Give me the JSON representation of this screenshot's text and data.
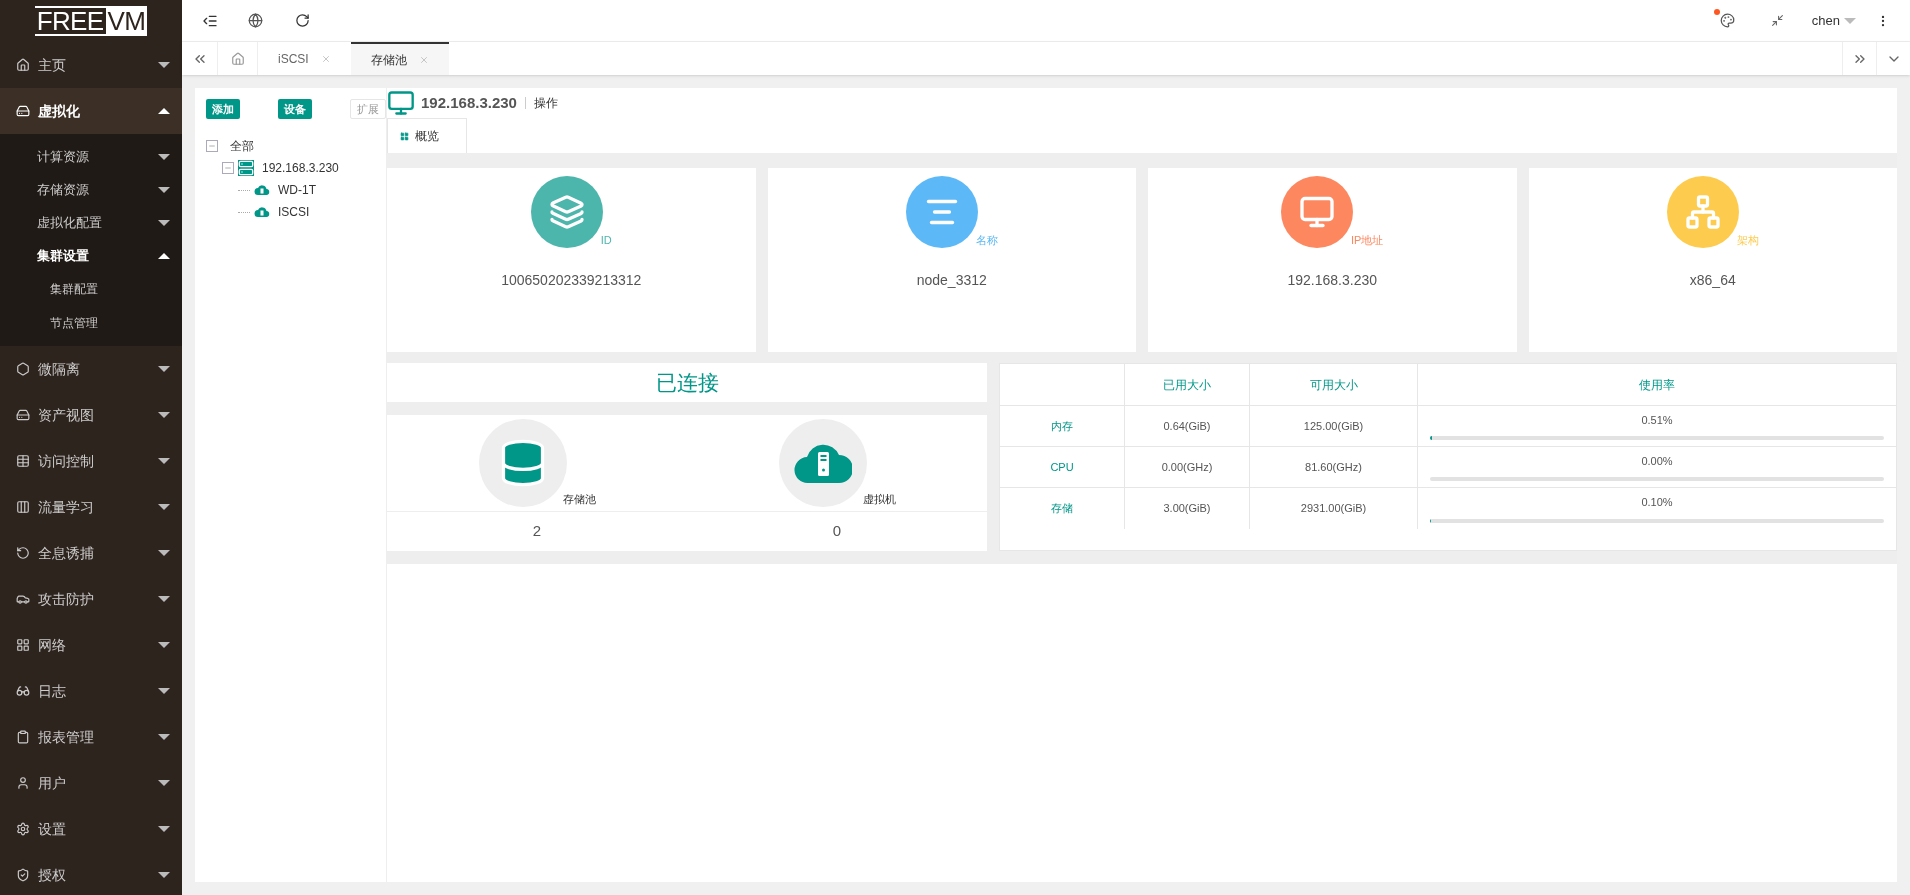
{
  "logo": {
    "part_1": "FREE",
    "part_2": "VM"
  },
  "top_bar": {
    "user": "chen",
    "notification": true
  },
  "tabs": [
    {
      "label": "iSCSI",
      "selected": false
    },
    {
      "label": "存储池",
      "selected": true
    }
  ],
  "sidebar": {
    "items": [
      {
        "label": "主页",
        "expanded": false,
        "selected": false
      },
      {
        "label": "虚拟化",
        "expanded": true,
        "selected": true,
        "children": [
          {
            "label": "计算资源",
            "expanded": false,
            "selected": false
          },
          {
            "label": "存储资源",
            "expanded": false,
            "selected": false
          },
          {
            "label": "虚拟化配置",
            "expanded": false,
            "selected": false
          },
          {
            "label": "集群设置",
            "expanded": true,
            "selected": true,
            "children": [
              {
                "label": "集群配置",
                "selected": false
              },
              {
                "label": "节点管理",
                "selected": false
              }
            ]
          }
        ]
      },
      {
        "label": "微隔离",
        "expanded": false,
        "selected": false
      },
      {
        "label": "资产视图",
        "expanded": false,
        "selected": false
      },
      {
        "label": "访问控制",
        "expanded": false,
        "selected": false
      },
      {
        "label": "流量学习",
        "expanded": false,
        "selected": false
      },
      {
        "label": "全息诱捕",
        "expanded": false,
        "selected": false
      },
      {
        "label": "攻击防护",
        "expanded": false,
        "selected": false
      },
      {
        "label": "网络",
        "expanded": false,
        "selected": false
      },
      {
        "label": "日志",
        "expanded": false,
        "selected": false
      },
      {
        "label": "报表管理",
        "expanded": false,
        "selected": false
      },
      {
        "label": "用户",
        "expanded": false,
        "selected": false
      },
      {
        "label": "设置",
        "expanded": false,
        "selected": false
      },
      {
        "label": "授权",
        "expanded": false,
        "selected": false
      }
    ]
  },
  "tree_panel": {
    "buttons": [
      {
        "label": "添加",
        "disabled": false
      },
      {
        "label": "设备",
        "disabled": false
      },
      {
        "label": "扩展",
        "disabled": true
      }
    ],
    "tree": [
      {
        "label": "全部",
        "kind": "group",
        "expanded": true,
        "children": [
          {
            "label": "192.168.3.230",
            "kind": "host",
            "expanded": true,
            "children": [
              {
                "label": "WD-1T",
                "kind": "pool"
              },
              {
                "label": "ISCSI",
                "kind": "pool"
              }
            ]
          }
        ]
      }
    ]
  },
  "node": {
    "title": "192.168.3.230",
    "action": "操作",
    "tabs": [
      {
        "label": "概览",
        "selected": true
      }
    ]
  },
  "info_cards": [
    {
      "label": "ID",
      "value": "100650202339213312",
      "color": "#4db6ac"
    },
    {
      "label": "名称",
      "value": "node_3312",
      "color": "#5cb8f6"
    },
    {
      "label": "IP地址",
      "value": "192.168.3.230",
      "color": "#fd875f"
    },
    {
      "label": "架构",
      "value": "x86_64",
      "color": "#fdcb4e"
    }
  ],
  "connection": {
    "status": "已连接",
    "counts": [
      {
        "label": "存储池",
        "value": "2"
      },
      {
        "label": "虚拟机",
        "value": "0"
      }
    ]
  },
  "usage_table": {
    "columns": [
      "已用大小",
      "可用大小",
      "使用率"
    ],
    "rows": [
      {
        "name": "内存",
        "used": "0.64(GiB)",
        "available": "125.00(GiB)",
        "rate": "0.51%",
        "level": 0.0051
      },
      {
        "name": "CPU",
        "used": "0.00(GHz)",
        "available": "81.60(GHz)",
        "rate": "0.00%",
        "level": 0
      },
      {
        "name": "存储",
        "used": "3.00(GiB)",
        "available": "2931.00(GiB)",
        "rate": "0.10%",
        "level": 0.001
      }
    ]
  }
}
